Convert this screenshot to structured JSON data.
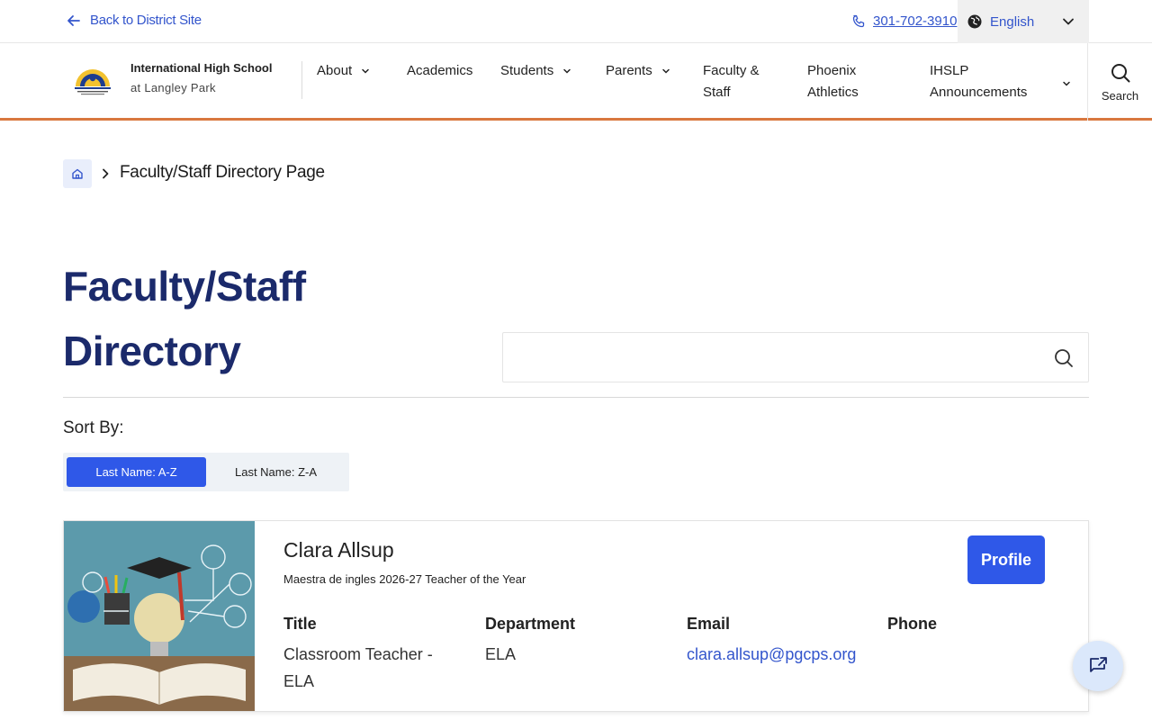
{
  "utility": {
    "back_label": "Back to District Site",
    "phone": "301-702-3910",
    "language": "English"
  },
  "header": {
    "school_name": "International High School",
    "school_sub": "at Langley Park",
    "nav": [
      {
        "label": "About"
      },
      {
        "label": "Academics"
      },
      {
        "label": "Students"
      },
      {
        "label": "Parents"
      },
      {
        "label_line1": "Faculty &",
        "label_line2": "Staff"
      },
      {
        "label_line1": "Phoenix",
        "label_line2": "Athletics"
      },
      {
        "label_line1": "IHSLP",
        "label_line2": "Announcements"
      }
    ],
    "search_label": "Search",
    "accent_color": "#d9783f"
  },
  "breadcrumb": {
    "current": "Faculty/Staff Directory Page"
  },
  "page": {
    "title": "Faculty/Staff Directory",
    "search_placeholder": ""
  },
  "sort": {
    "label": "Sort By:",
    "options": [
      "Last Name: A-Z",
      "Last Name: Z-A"
    ],
    "selected": "Last Name: A-Z"
  },
  "staff": [
    {
      "name": "Clara Allsup",
      "subtitle": "Maestra de ingles 2026-27 Teacher of the Year",
      "profile_label": "Profile",
      "fields": {
        "title_label": "Title",
        "title_value": "Classroom Teacher - ELA",
        "department_label": "Department",
        "department_value": "ELA",
        "email_label": "Email",
        "email_value": "clara.allsup@pgcps.org",
        "phone_label": "Phone",
        "phone_value": ""
      }
    }
  ],
  "colors": {
    "primary_blue": "#2f58e8",
    "title_navy": "#1b2a6b",
    "link_blue": "#3355cc"
  }
}
